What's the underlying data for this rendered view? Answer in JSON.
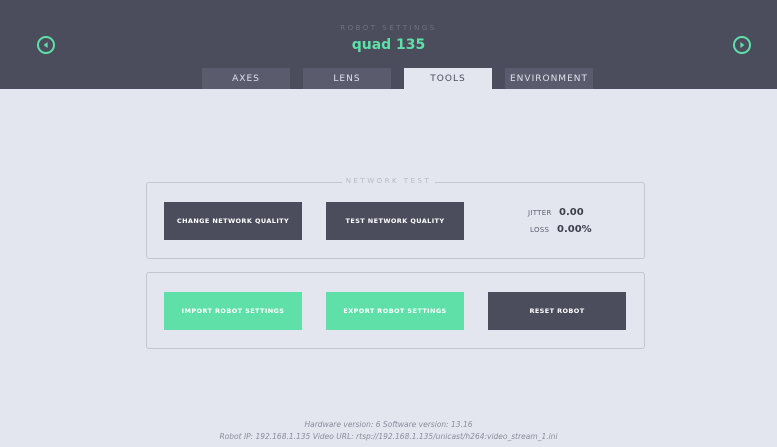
{
  "header": {
    "subtitle": "ROBOT SETTINGS",
    "title": "quad 135",
    "prev_icon": "chevron-left-icon",
    "next_icon": "chevron-right-icon"
  },
  "tabs": [
    {
      "label": "AXES",
      "active": false
    },
    {
      "label": "LENS",
      "active": false
    },
    {
      "label": "TOOLS",
      "active": true
    },
    {
      "label": "ENVIRONMENT",
      "active": false
    }
  ],
  "network_test": {
    "legend": "NETWORK TEST",
    "change_quality_label": "CHANGE NETWORK QUALITY",
    "test_quality_label": "TEST NETWORK QUALITY",
    "jitter_label": "JITTER",
    "jitter_value": "0.00",
    "loss_label": "LOSS",
    "loss_value": "0.00%"
  },
  "robot_actions": {
    "import_label": "IMPORT ROBOT SETTINGS",
    "export_label": "EXPORT ROBOT SETTINGS",
    "reset_label": "RESET ROBOT"
  },
  "footer": {
    "versions": "Hardware version: 6 Software version: 13.16",
    "robot_info": "Robot IP: 192.168.1.135  Video URL: rtsp://192.168.1.135/unicast/h264:video_stream_1.ini"
  },
  "colors": {
    "accent": "#5ee0a8",
    "header_bg": "#4b4c5c",
    "page_bg": "#e3e6ee"
  }
}
